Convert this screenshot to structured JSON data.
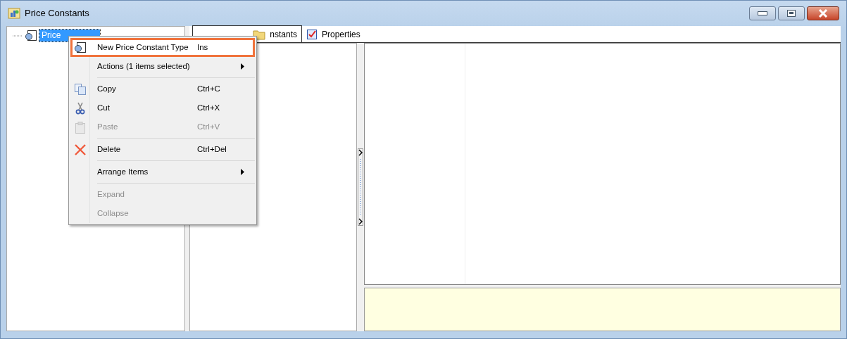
{
  "window": {
    "title": "Price Constants"
  },
  "tree": {
    "items": [
      {
        "label": "Price",
        "selected": true
      }
    ]
  },
  "tabs": [
    {
      "label": "nstants",
      "selected": true
    },
    {
      "label": "Properties",
      "selected": false
    }
  ],
  "context_menu": {
    "items": [
      {
        "kind": "item",
        "label": "New Price Constant Type",
        "shortcut": "Ins",
        "submenu": false,
        "selected": true,
        "disabled": false
      },
      {
        "kind": "item",
        "label": "Actions (1 items selected)",
        "submenu": true,
        "selected": false,
        "disabled": false
      },
      {
        "kind": "separator"
      },
      {
        "kind": "item",
        "label": "Copy",
        "shortcut": "Ctrl+C",
        "submenu": false,
        "selected": false,
        "disabled": false
      },
      {
        "kind": "item",
        "label": "Cut",
        "shortcut": "Ctrl+X",
        "submenu": false,
        "selected": false,
        "disabled": false
      },
      {
        "kind": "item",
        "label": "Paste",
        "shortcut": "Ctrl+V",
        "submenu": false,
        "selected": false,
        "disabled": true
      },
      {
        "kind": "separator"
      },
      {
        "kind": "item",
        "label": "Delete",
        "shortcut": "Ctrl+Del",
        "submenu": false,
        "selected": false,
        "disabled": false
      },
      {
        "kind": "separator"
      },
      {
        "kind": "item",
        "label": "Arrange Items",
        "submenu": true,
        "selected": false,
        "disabled": false
      },
      {
        "kind": "separator"
      },
      {
        "kind": "item",
        "label": "Expand",
        "submenu": false,
        "selected": false,
        "disabled": true
      },
      {
        "kind": "item",
        "label": "Collapse",
        "submenu": false,
        "selected": false,
        "disabled": true
      }
    ]
  }
}
